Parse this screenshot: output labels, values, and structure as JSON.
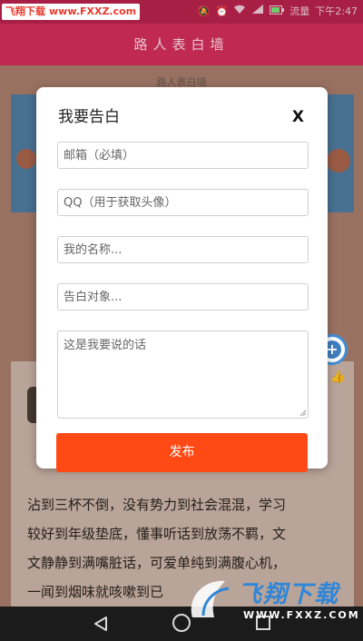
{
  "status_bar": {
    "watermark": "飞翔下载",
    "watermark_url": "www.FXXZ.com",
    "time": "下午2:47",
    "network": "流量"
  },
  "app": {
    "title": "路人表白墙",
    "subtitle": "路人表白墙"
  },
  "background_post": {
    "lines": [
      "沾到三杯不倒，没有势力到社会混混，学习",
      "较好到年级垫底，懂事听话到放荡不羁，文",
      "文静静到满嘴脏话，可爱单纯到满腹心机，",
      "一闻到烟味就咳嗽到已"
    ]
  },
  "modal": {
    "title": "我要告白",
    "close_label": "X",
    "email_placeholder": "邮箱（必填）",
    "qq_placeholder": "QQ（用于获取头像）",
    "name_placeholder": "我的名称...",
    "target_placeholder": "告白对象...",
    "message_placeholder": "这是我要说的话",
    "submit_label": "发布"
  },
  "fab": {
    "label": "+"
  },
  "watermark_logo": {
    "text": "飞翔下载",
    "url": "WWW.FXXZ.COM"
  },
  "colors": {
    "appbar": "#c02a52",
    "submit": "#ff4a16",
    "fab_ring": "#3f8fd6"
  },
  "icons": [
    "mute-icon",
    "alarm-icon",
    "wifi-icon",
    "signal-icon",
    "battery-icon",
    "thumb-up-icon",
    "add-icon",
    "back-icon",
    "home-icon",
    "recent-apps-icon"
  ]
}
